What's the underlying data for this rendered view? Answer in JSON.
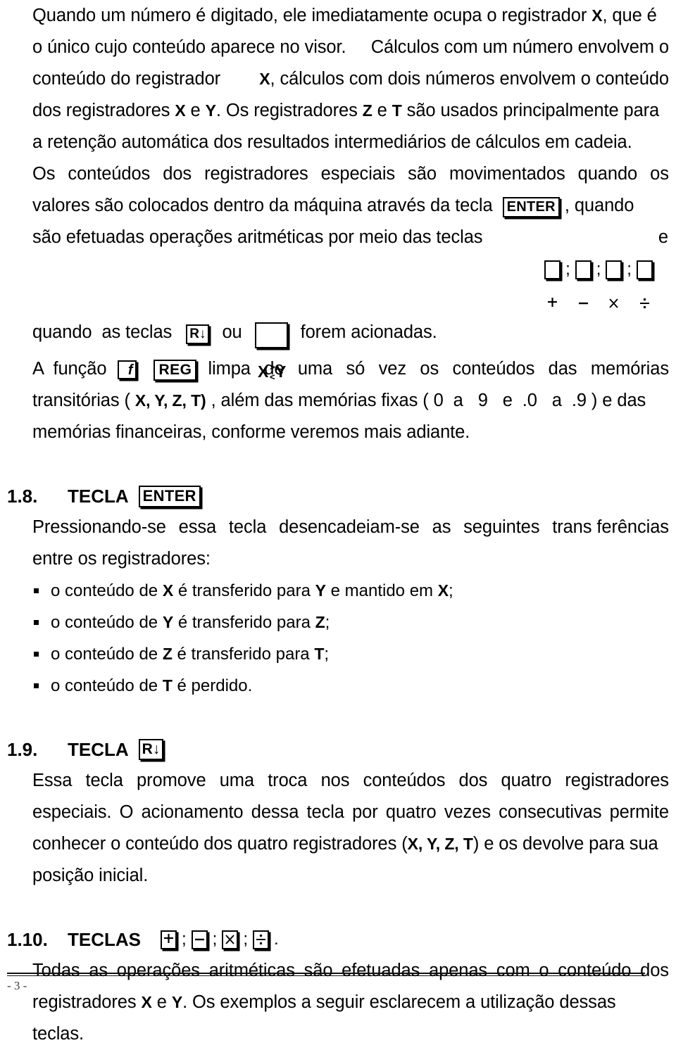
{
  "document": {
    "page_number": "- 3 -",
    "language": "pt-BR"
  },
  "paragraphs": {
    "p1": {
      "line1": "Quando um número é digitado, ele imediatamente ocupa o registrador ",
      "line1_reg": "X",
      "line1_end": ", que é",
      "line2a": "o único cujo conteúdo aparece no visor.",
      "line2b": "Cálculos com um número envolvem o",
      "line3a": "conteúdo do registrador ",
      "line3_reg": "X",
      "line3b": ", cálculos com dois números envolvem o conteúdo",
      "line4a": "dos registradores ",
      "line4_reg1": "X",
      "line4b": " e ",
      "line4_reg2": "Y",
      "line4c": ". Os registradores ",
      "line4_reg3": "Z",
      "line4d": " e ",
      "line4_reg4": "T",
      "line4e": " são usados principalmente para",
      "line5": "a retenção automática dos resultados intermediários de cálculos em cadeia."
    },
    "p2": {
      "line1_w": [
        "Os",
        "conteúdos",
        "dos",
        "registradores",
        "especiais",
        "são",
        "movimentados",
        "quando",
        "os"
      ],
      "line2a": "valores são colocados dentro da máquina através da tecla",
      "line2_key": "ENTER",
      "line2b": ", quando",
      "line3a": "são efetuadas operações aritméticas por meio das teclas",
      "line3_keys": [
        "plus-key",
        "minus-key",
        "times-key",
        "divide-key"
      ],
      "line3b": "e",
      "line4a": "quando  as teclas",
      "line4_key1": "R↓",
      "line4b": "ou",
      "line4_key2": "X⋛Y",
      "line4c": "forem acionadas.",
      "line5a": "A  função",
      "line5_key1": "f",
      "line5_key2": "REG",
      "line5_w": [
        "limpa",
        "de",
        "uma",
        "só",
        "vez",
        "os",
        "conteúdos",
        "das",
        "memórias"
      ],
      "line6a": "transitórias ( ",
      "line6_regs": "X, Y, Z, T)",
      "line6b": " , além das memórias fixas ( 0  a   9   e  .0   a  .9 ) e das",
      "line7": "memórias financeiras, conforme veremos mais adiante."
    },
    "p3": {
      "line1_w": [
        "Pressionando-se",
        "essa",
        "tecla",
        "desencadeiam-se",
        "as",
        "seguintes",
        "trans ferências"
      ],
      "line2": "entre os registradores:"
    },
    "p4": {
      "line1_w": [
        "Essa",
        "tecla",
        "promove",
        "uma",
        "troca",
        "nos",
        "conteúdos",
        "dos",
        "quatro",
        "registradores"
      ],
      "line2_w": [
        "especiais.",
        "O",
        "acionamento",
        "dessa",
        "tecla",
        "por",
        "quatro",
        "vezes",
        "consecutivas",
        "permite"
      ],
      "line3a": "conhecer o conteúdo dos quatro registradores (",
      "line3_regs": "X, Y, Z, T",
      "line3b": ") e os devolve para sua",
      "line4": "posição inicial."
    },
    "p5": {
      "line1_w": [
        "Todas",
        "as",
        "operações",
        "aritméticas",
        "são",
        "efetuadas",
        "apenas",
        "com",
        "o",
        "conteúdo",
        "dos"
      ],
      "line2a": "registradores ",
      "line2_reg1": "X",
      "line2b": " e ",
      "line2_reg2": "Y",
      "line2c": ". Os exemplos a seguir esclarecem a utilização dessas",
      "line3": "teclas."
    }
  },
  "sections": {
    "s18": {
      "number": "1.8.",
      "title": "TECLA",
      "key": "ENTER"
    },
    "s19": {
      "number": "1.9.",
      "title": "TECLA",
      "key": "R↓"
    },
    "s110": {
      "number": "1.10.",
      "title": "TECLAS",
      "keys": [
        "plus-key",
        "minus-key",
        "times-key",
        "divide-key"
      ],
      "terminator": "."
    }
  },
  "bullet_list": [
    {
      "pre": "o conteúdo de ",
      "reg1": "X",
      "mid": " é transferido para ",
      "reg2": "Y",
      "post": " e mantido em ",
      "reg3": "X",
      "end": ";"
    },
    {
      "pre": "o conteúdo de ",
      "reg1": "Y",
      "mid": " é transferido para ",
      "reg2": "Z",
      "post": "",
      "reg3": "",
      "end": ";"
    },
    {
      "pre": "o conteúdo de ",
      "reg1": "Z",
      "mid": " é transferido para ",
      "reg2": "T",
      "post": "",
      "reg3": "",
      "end": ";"
    },
    {
      "pre": "o conteúdo de ",
      "reg1": "T",
      "mid": " é perdido",
      "reg2": "",
      "post": "",
      "reg3": "",
      "end": "."
    }
  ],
  "keys": {
    "enter_label": "ENTER",
    "reg_label": "REG",
    "f_label": "f",
    "rolldown_label": "R",
    "rolldown_arrow": "↓",
    "xy_x": "X",
    "xy_y": "Y",
    "xy_gt": ">",
    "xy_lt": "<",
    "plus": "+",
    "minus": "−",
    "times": "×",
    "divide": "÷",
    "separator": ";"
  },
  "colors": {
    "ink": "#000000",
    "paper": "#ffffff",
    "footer_text": "#3a3a3a"
  }
}
